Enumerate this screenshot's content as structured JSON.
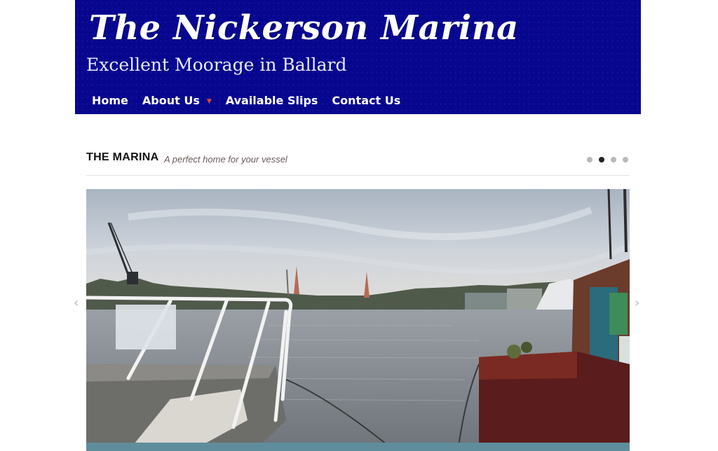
{
  "header": {
    "site_title": "The Nickerson Marina",
    "tagline": "Excellent Moorage in Ballard",
    "brand_color": "#06068f"
  },
  "nav": {
    "items": [
      {
        "label": "Home"
      },
      {
        "label": "About Us",
        "has_dropdown": true
      },
      {
        "label": "Available Slips"
      },
      {
        "label": "Contact Us"
      }
    ]
  },
  "slider": {
    "section_title": "THE MARINA",
    "section_subtitle": "A perfect home for your vessel",
    "slide_count": 4,
    "active_index": 1,
    "prev_icon": "chevron-left-icon",
    "next_icon": "chevron-right-icon",
    "prev_glyph": "‹",
    "next_glyph": "›"
  }
}
